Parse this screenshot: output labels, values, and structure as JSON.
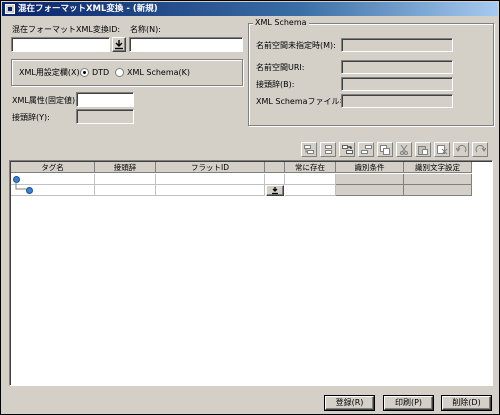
{
  "window": {
    "title": "混在フォーマットXML変換 - (新規)"
  },
  "left_form": {
    "format_id_label": "混在フォーマットXML変換ID:",
    "format_id_value": "",
    "name_label": "名称(N):",
    "name_value": "",
    "xml_setting_label": "XML用設定欄(X):",
    "dtd_label": "DTD",
    "xml_schema_label": "XML Schema(K)",
    "selected": "DTD",
    "xml_attr_label": "XML属性(固定値):",
    "xml_attr_value": "",
    "prefix_label": "接頭辞(Y):",
    "prefix_value": ""
  },
  "schema_group": {
    "title": "XML Schema",
    "ns_unspecified_label": "名前空間未指定時(M):",
    "ns_uri_label": "名前空間URI:",
    "prefix_label": "接頭辞(B):",
    "schema_file_label": "XML Schemaファイル名:"
  },
  "toolbar": {
    "icons": [
      "insert-child-icon",
      "insert-sibling-icon",
      "move-in-icon",
      "move-out-icon",
      "copy-icon",
      "cut-icon",
      "paste-icon",
      "delete-icon",
      "undo-icon",
      "redo-icon"
    ]
  },
  "grid": {
    "columns": [
      "タグ名",
      "接頭辞",
      "フラットID",
      "",
      "常に存在",
      "識別条件",
      "識別文字設定"
    ]
  },
  "buttons": {
    "register": "登録(R)",
    "print": "印刷(P)",
    "delete": "削除(D)"
  },
  "colors": {
    "title_start": "#0a246a",
    "title_end": "#a6caf0",
    "node": "#3a7fd6",
    "face": "#d4d0c8"
  }
}
